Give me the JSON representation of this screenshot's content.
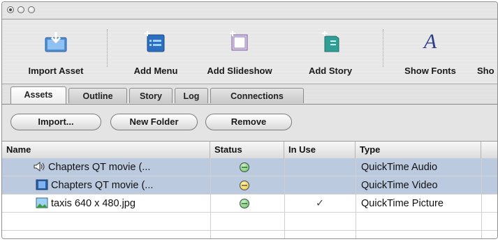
{
  "window": {
    "buttons": [
      "close-button",
      "minimize-button",
      "zoom-button"
    ]
  },
  "toolbar": {
    "items": [
      {
        "label": "Import Asset",
        "icon": "import-asset-icon"
      },
      {
        "label": "Add Menu",
        "icon": "add-menu-icon"
      },
      {
        "label": "Add Slideshow",
        "icon": "add-slideshow-icon"
      },
      {
        "label": "Add Story",
        "icon": "add-story-icon"
      },
      {
        "label": "Show Fonts",
        "icon": "fonts-icon",
        "glyph": "A"
      },
      {
        "label": "Sho"
      }
    ]
  },
  "tabs": [
    {
      "label": "Assets",
      "active": true
    },
    {
      "label": "Outline",
      "active": false
    },
    {
      "label": "Story",
      "active": false
    },
    {
      "label": "Log",
      "active": false
    },
    {
      "label": "Connections",
      "active": false
    }
  ],
  "buttons": {
    "import": "Import...",
    "new_folder": "New Folder",
    "remove": "Remove"
  },
  "table": {
    "columns": [
      "Name",
      "Status",
      "In Use",
      "Type"
    ],
    "rows": [
      {
        "name": "Chapters QT movie (...",
        "icon": "speaker-icon",
        "status": "green",
        "in_use": "",
        "type": "QuickTime Audio",
        "selected": true
      },
      {
        "name": "Chapters QT movie (...",
        "icon": "video-icon",
        "status": "yellow",
        "in_use": "",
        "type": "QuickTime Video",
        "selected": true
      },
      {
        "name": "taxis 640 x 480.jpg",
        "icon": "picture-icon",
        "status": "green",
        "in_use": "✓",
        "type": "QuickTime Picture",
        "selected": false
      }
    ]
  },
  "colors": {
    "selection": "#bccadf",
    "status_green": "#5cc25c",
    "status_yellow": "#e3c83a"
  }
}
